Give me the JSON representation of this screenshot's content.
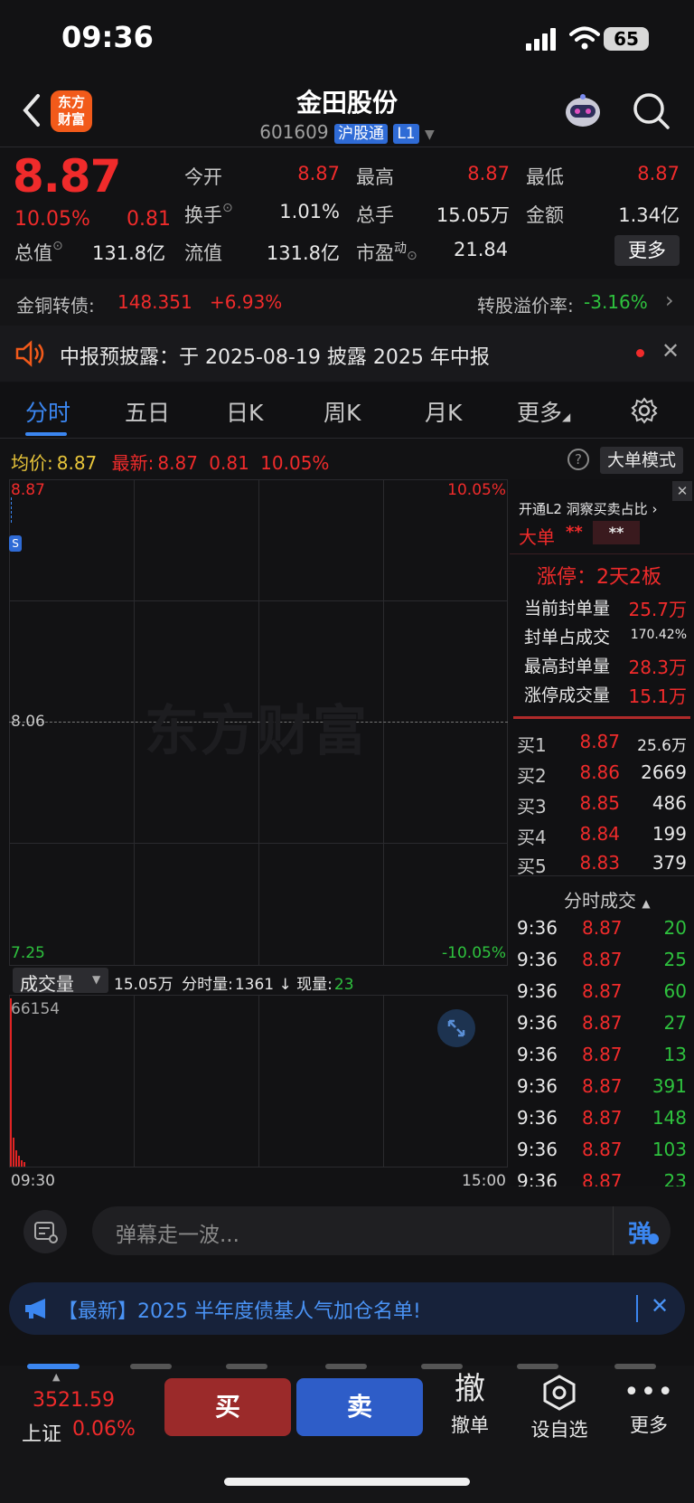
{
  "status": {
    "time": "09:36",
    "battery": "65"
  },
  "header": {
    "logo_line1": "东方",
    "logo_line2": "财富",
    "name": "金田股份",
    "code": "601609",
    "tag1": "沪股通",
    "tag2": "L1"
  },
  "quote": {
    "price": "8.87",
    "pct": "10.05%",
    "chg": "0.81",
    "open_l": "今开",
    "open_v": "8.87",
    "high_l": "最高",
    "high_v": "8.87",
    "low_l": "最低",
    "low_v": "8.87",
    "turn_l": "换手",
    "turn_v": "1.01%",
    "vol_l": "总手",
    "vol_v": "15.05万",
    "amt_l": "金额",
    "amt_v": "1.34亿",
    "mcap_l": "总值",
    "mcap_v": "131.8亿",
    "flt_l": "流值",
    "flt_v": "131.8亿",
    "pe_l": "市盈",
    "pe_sup": "动",
    "pe_v": "21.84",
    "more": "更多"
  },
  "bond": {
    "label": "金铜转债:",
    "price": "148.351",
    "pct": "+6.93%",
    "prem_l": "转股溢价率:",
    "prem_v": "-3.16%"
  },
  "notice": {
    "text": "中报预披露：于 2025-08-19 披露 2025 年中报"
  },
  "tabs": [
    {
      "label": "分时"
    },
    {
      "label": "五日"
    },
    {
      "label": "日K"
    },
    {
      "label": "周K"
    },
    {
      "label": "月K"
    },
    {
      "label": "更多"
    }
  ],
  "chart_info": {
    "avg_l": "均价:",
    "avg_v": "8.87",
    "last_l": "最新:",
    "last_v": "8.87",
    "chg": "0.81",
    "pct": "10.05%",
    "mode_btn": "大单模式"
  },
  "chart": {
    "y_top": "8.87",
    "y_mid": "8.06",
    "y_bot": "7.25",
    "pct_top": "10.05%",
    "pct_bot": "-10.05%",
    "watermark": "东方财富",
    "marker": "S"
  },
  "volume": {
    "selector": "成交量",
    "total": "15.05万",
    "min_l": "分时量:",
    "min_v": "1361",
    "now_l": "现量:",
    "now_v": "23",
    "ymax": "66154",
    "t_start": "09:30",
    "t_end": "15:00"
  },
  "l2": {
    "promo": "开通L2 洞察买卖占比",
    "big_l": "大单",
    "big_v": "**",
    "big_v2": "**",
    "limit": "涨停：2天2板",
    "rows": [
      {
        "l": "当前封单量",
        "v": "25.7万"
      },
      {
        "l": "封单占成交",
        "v": "170.42%"
      },
      {
        "l": "最高封单量",
        "v": "28.3万"
      },
      {
        "l": "涨停成交量",
        "v": "15.1万"
      }
    ]
  },
  "book": [
    {
      "l": "买1",
      "p": "8.87",
      "v": "25.6万"
    },
    {
      "l": "买2",
      "p": "8.86",
      "v": "2669"
    },
    {
      "l": "买3",
      "p": "8.85",
      "v": "486"
    },
    {
      "l": "买4",
      "p": "8.84",
      "v": "199"
    },
    {
      "l": "买5",
      "p": "8.83",
      "v": "379"
    }
  ],
  "trades_title": "分时成交",
  "trades": [
    {
      "t": "9:36",
      "p": "8.87",
      "v": "20"
    },
    {
      "t": "9:36",
      "p": "8.87",
      "v": "25"
    },
    {
      "t": "9:36",
      "p": "8.87",
      "v": "60"
    },
    {
      "t": "9:36",
      "p": "8.87",
      "v": "27"
    },
    {
      "t": "9:36",
      "p": "8.87",
      "v": "13"
    },
    {
      "t": "9:36",
      "p": "8.87",
      "v": "391"
    },
    {
      "t": "9:36",
      "p": "8.87",
      "v": "148"
    },
    {
      "t": "9:36",
      "p": "8.87",
      "v": "103"
    },
    {
      "t": "9:36",
      "p": "8.87",
      "v": "23"
    }
  ],
  "comment": {
    "placeholder": "弹幕走一波...",
    "send": "弹"
  },
  "banner": {
    "text": "【最新】2025 半年度债基人气加仓名单!"
  },
  "bottom": {
    "index_v": "3521.59",
    "index_l": "上证",
    "index_pct": "0.06%",
    "buy": "买",
    "sell": "卖",
    "cancel_icon": "撤",
    "cancel": "撤单",
    "fav": "设自选",
    "more": "更多"
  },
  "colors": {
    "up": "#f02b2b",
    "down": "#2ec23e",
    "accent": "#3b86f0",
    "avg": "#e8c53a"
  }
}
